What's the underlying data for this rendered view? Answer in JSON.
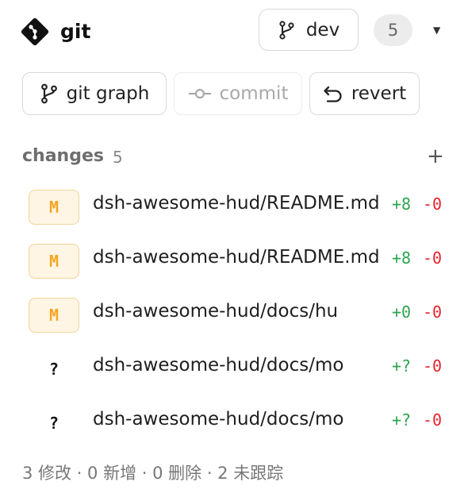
{
  "header": {
    "title": "git",
    "branch": "dev",
    "count": "5",
    "icons": {
      "logo": "git-logo-icon",
      "branch": "git-branch-icon",
      "caret": "chevron-down-icon"
    }
  },
  "toolbar": {
    "graph_label": "git graph",
    "commit_label": "commit",
    "revert_label": "revert"
  },
  "changes": {
    "title": "changes",
    "count": "5",
    "add_symbol": "+",
    "items": [
      {
        "status": "M",
        "path": "dsh-awesome-hud/README.md",
        "added": "+8",
        "removed": "-0"
      },
      {
        "status": "M",
        "path": "dsh-awesome-hud/README.md",
        "added": "+8",
        "removed": "-0"
      },
      {
        "status": "M",
        "path": "dsh-awesome-hud/docs/hu",
        "added": "+0",
        "removed": "-0"
      },
      {
        "status": "?",
        "path": "dsh-awesome-hud/docs/mo",
        "added": "+?",
        "removed": "-0"
      },
      {
        "status": "?",
        "path": "dsh-awesome-hud/docs/mo",
        "added": "+?",
        "removed": "-0"
      }
    ]
  },
  "summary": "3 修改 · 0 新增 · 0 删除 · 2 未跟踪",
  "colors": {
    "modified_badge": "#f5a623",
    "added": "#2ea44f",
    "removed": "#e5232b"
  }
}
